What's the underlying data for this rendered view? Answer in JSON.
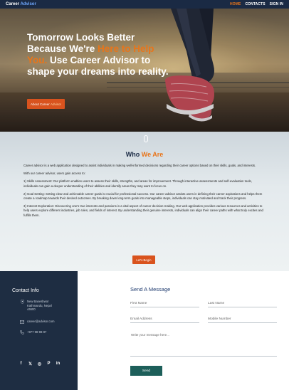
{
  "nav": {
    "brand_main": "Career",
    "brand_accent": "Advisor",
    "links": [
      "HOME",
      "CONTACTS",
      "SIGN IN"
    ]
  },
  "hero": {
    "title_part1": "Tomorrow Looks Better Because We're ",
    "title_highlight": "Here to Help You.",
    "title_part2": " Use Career Advisor to shape your dreams into reality.",
    "button_main": "About Career ",
    "button_accent": "Advisor"
  },
  "about": {
    "title_main": "Who",
    "title_accent": "We Are",
    "paragraphs": [
      "Career advisor is a web application designed to assist individuals in making well-informed decisions regarding their career options based on their skills, goals, and interests.",
      "With our career advisor, users gain access to:",
      "1) Skills Assessment: Our platform enables users to assess their skills, strengths, and areas for improvement. Through interactive assessments and self-evaluation tools, individuals can gain a deeper understanding of their abilities and identify areas they may want to focus on.",
      "2) Goal Setting: Setting clear and achievable career goals is crucial for professional success. Our career advisor assists users in defining their career aspirations and helps them create a roadmap towards their desired outcomes. By breaking down long-term goals into manageable steps, individuals can stay motivated and track their progress.",
      "3) Interest Exploration: Discovering one's true interests and passions is a vital aspect of career decision-making. Our web application provides various resources and activities to help users explore different industries, job roles, and fields of interest. By understanding their genuine interests, individuals can align their career paths with what truly excites and fulfills them."
    ],
    "button": "Let's Begin"
  },
  "contact_info": {
    "title": "Contact Info",
    "address_line1": "New Baneshwor",
    "address_line2": "Kathmandu, Nepal",
    "address_line3": "44600",
    "email": "career@advisor.com",
    "phone": "+977 98-98-97",
    "socials": [
      "f",
      "𝕏",
      "◎",
      "P",
      "in"
    ]
  },
  "form": {
    "title": "Send A Message",
    "first_name": "First Name",
    "last_name": "Last Name",
    "email": "Email Address",
    "mobile": "Mobile Number",
    "message": "Write your message here...",
    "send": "Send"
  }
}
